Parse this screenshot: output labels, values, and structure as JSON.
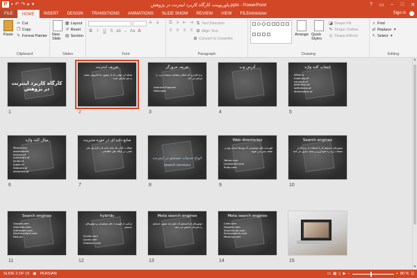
{
  "window": {
    "title": "پاورپوینت کارگاه کاربرد اینترنت در پژوهش.pptx - PowerPoint",
    "sign_in": "Sign in",
    "controls": {
      "help": "?",
      "ribbon_opts": "▭",
      "minimize": "–",
      "restore": "□",
      "close": "✕"
    }
  },
  "tabs": [
    "FILE",
    "HOME",
    "INSERT",
    "DESIGN",
    "TRANSITIONS",
    "ANIMATIONS",
    "SLIDE SHOW",
    "REVIEW",
    "VIEW",
    "FILEminimizer"
  ],
  "active_tab": "HOME",
  "ribbon": {
    "clipboard": {
      "label": "Clipboard",
      "paste": "Paste",
      "cut": "Cut",
      "copy": "Copy",
      "format_painter": "Format Painter"
    },
    "slides": {
      "label": "Slides",
      "new_slide": "New Slide",
      "layout": "Layout",
      "reset": "Reset",
      "section": "Section"
    },
    "font": {
      "label": "Font"
    },
    "paragraph": {
      "label": "Paragraph",
      "text_direction": "Text Direction",
      "align_text": "Align Text",
      "convert": "Convert to SmartArt"
    },
    "drawing": {
      "label": "Drawing",
      "arrange": "Arrange",
      "quick_styles": "Quick Styles",
      "shape_fill": "Shape Fill",
      "shape_outline": "Shape Outline",
      "shape_effects": "Shape Effects"
    },
    "editing": {
      "label": "Editing",
      "find": "Find",
      "replace": "Replace",
      "select": "Select"
    }
  },
  "slides": [
    {
      "num": "1",
      "title": "کارگاه کاربرد اینترنت در پژوهش",
      "body": "",
      "list": []
    },
    {
      "num": "2",
      "title": "تعریف اینترنت",
      "body": "شبکه ای جهانی که از میلیون ها کامپیوتر متصل به هم تشکیل شده",
      "list": []
    },
    {
      "num": "3",
      "title": "تعریف مرورگر",
      "body": "نرم افزاری که امکان مشاهده صفحات وب را فراهم می کند",
      "list": [
        "Internet Explorer",
        "Netscape"
      ]
    },
    {
      "num": "4",
      "title": "آدرس وب",
      "body": "",
      "list": []
    },
    {
      "num": "5",
      "title": "انتخاب کلید واژه",
      "body": "",
      "list": [
        "What is",
        "meaning of",
        "concept of",
        "definition of",
        "definitions of",
        "dimensions of"
      ]
    },
    {
      "num": "6",
      "title": "مثال کلید واژه",
      "body": "",
      "list": [
        "Measuring",
        "assessment",
        "factors of",
        "indicators of",
        "kinds of",
        "types of",
        "features of",
        "elements of"
      ]
    },
    {
      "num": "7",
      "title": "منابع داده ای در حوزه مدیریت",
      "body": "مقالات، کتاب ها، پایان نامه ها و گزارش های علمی در پایگاه های اطلاعاتی",
      "list": []
    },
    {
      "num": "8",
      "title": "",
      "body": "",
      "center": "انواع خدمات جستجو در اینترنت",
      "center2": "search services",
      "list": []
    },
    {
      "num": "9",
      "title": "Web directories",
      "body": "فهرست های موضوعی که توسط انسان تهیه و طبقه بندی می شوند",
      "list": [
        "Yahoo.com",
        "Looksmart.com",
        "Snap.com"
      ]
    },
    {
      "num": "10",
      "title": "Search engines",
      "body": "موتورهای جستجو که با استفاده از نرم افزار صفحات وب را جمع آوری و نمایه سازی می کنند",
      "list": []
    },
    {
      "num": "11",
      "title": "Search engines",
      "body": "",
      "list": [
        "Google.com",
        "Altavista.com",
        "Alltheweb.com",
        "Northernlight.com",
        "Fast.no"
      ]
    },
    {
      "num": "12",
      "title": "hybrids",
      "body": "ترکیبی از فهرست های موضوعی و موتورهای جستجو",
      "list": [
        "Excite.com",
        "Lycos.com",
        "Infoseek.com"
      ]
    },
    {
      "num": "13",
      "title": "Meta search engines",
      "body": "موتورهای فراجستجو که نتایج چند موتور جستجو را همزمان نمایش می دهند",
      "list": []
    },
    {
      "num": "14",
      "title": "Meta search engines",
      "body": "",
      "list": [
        "Cnet.com",
        "Dogpile.com",
        "Search4-all.com",
        "Savvysearch.com",
        "Mamma.com"
      ]
    },
    {
      "num": "15",
      "title": "",
      "body": "",
      "list": []
    }
  ],
  "selected_slide": "2",
  "status": {
    "slide_info": "SLIDE 2 OF 15",
    "language": "PERSIAN",
    "zoom": "80 %"
  },
  "colors": {
    "accent": "#d24726",
    "ribbon_bg": "#f3f3f3",
    "sorter_bg": "#e6e6e6"
  }
}
